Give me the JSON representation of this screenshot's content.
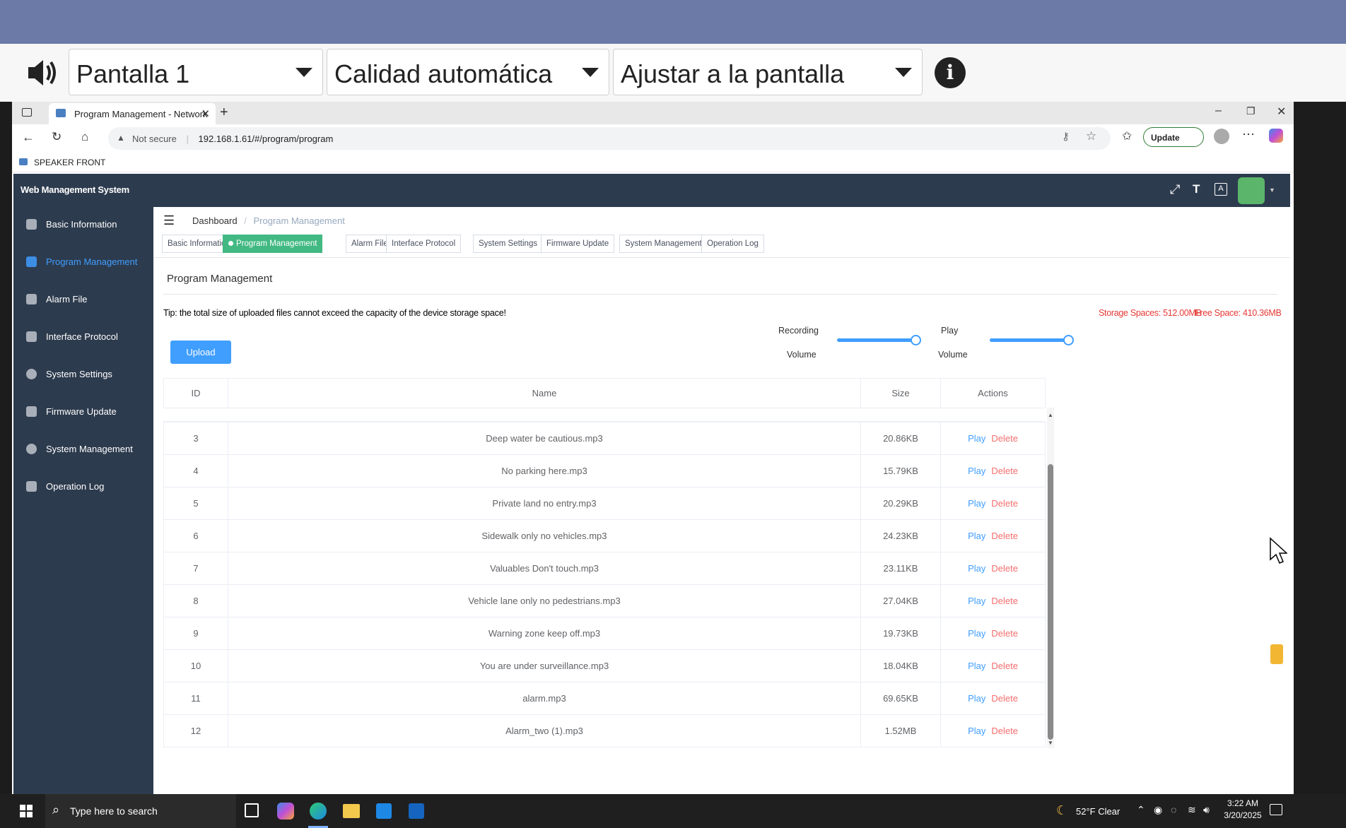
{
  "remote_bar": {
    "screen_select": "Pantalla 1",
    "quality_select": "Calidad automática",
    "fit_select": "Ajustar a la pantalla"
  },
  "browser": {
    "tab_title": "Program Management - Network",
    "security": "Not secure",
    "url": "192.168.1.61/#/program/program",
    "update_label": "Update",
    "favorite": "SPEAKER FRONT"
  },
  "app": {
    "title": "Web Management System",
    "sidebar": [
      {
        "label": "Basic Information"
      },
      {
        "label": "Program Management"
      },
      {
        "label": "Alarm File"
      },
      {
        "label": "Interface Protocol"
      },
      {
        "label": "System Settings"
      },
      {
        "label": "Firmware Update"
      },
      {
        "label": "System Management"
      },
      {
        "label": "Operation Log"
      }
    ],
    "breadcrumb": {
      "home": "Dashboard",
      "sep": "/",
      "current": "Program Management"
    },
    "tags": [
      "Basic Information",
      "Program Management",
      "Alarm File",
      "Interface Protocol",
      "System Settings",
      "Firmware Update",
      "System Management",
      "Operation Log"
    ],
    "section_title": "Program Management",
    "tip": "Tip: the total size of uploaded files cannot exceed the capacity of the device storage space!",
    "storage": "Storage Spaces: 512.00MB",
    "free": "Free Space: 410.36MB",
    "upload_label": "Upload",
    "recording_label_1": "Recording",
    "recording_label_2": "Volume",
    "recording_level": 1.0,
    "play_label_1": "Play",
    "play_label_2": "Volume",
    "play_level": 1.0,
    "table": {
      "headers": [
        "ID",
        "Name",
        "Size",
        "Actions"
      ],
      "play_label": "Play",
      "delete_label": "Delete",
      "rows": [
        [
          "3",
          "Deep water be cautious.mp3",
          "20.86KB"
        ],
        [
          "4",
          "No parking here.mp3",
          "15.79KB"
        ],
        [
          "5",
          "Private land no entry.mp3",
          "20.29KB"
        ],
        [
          "6",
          "Sidewalk only no vehicles.mp3",
          "24.23KB"
        ],
        [
          "7",
          "Valuables Don't touch.mp3",
          "23.11KB"
        ],
        [
          "8",
          "Vehicle lane only no pedestrians.mp3",
          "27.04KB"
        ],
        [
          "9",
          "Warning zone keep off.mp3",
          "19.73KB"
        ],
        [
          "10",
          "You are under surveillance.mp3",
          "18.04KB"
        ],
        [
          "11",
          "alarm.mp3",
          "69.65KB"
        ],
        [
          "12",
          "Alarm_two (1).mp3",
          "1.52MB"
        ]
      ]
    }
  },
  "taskbar": {
    "search_placeholder": "Type here to search",
    "weather": "52°F  Clear",
    "time": "3:22 AM",
    "date": "3/20/2025"
  },
  "colors": {
    "sidebar": "#2d3b4e",
    "active_tag": "#42b983",
    "primary": "#409eff",
    "danger": "#f56c6c"
  }
}
